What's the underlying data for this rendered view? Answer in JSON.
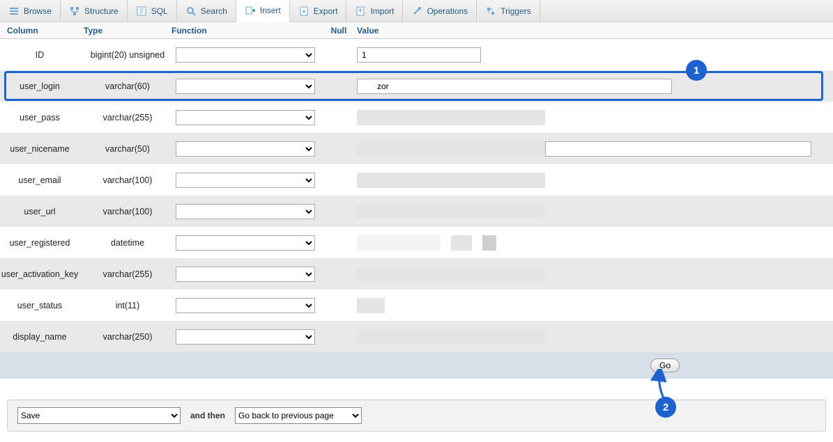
{
  "tabs": [
    {
      "label": "Browse",
      "icon": "browse-icon"
    },
    {
      "label": "Structure",
      "icon": "structure-icon"
    },
    {
      "label": "SQL",
      "icon": "sql-icon"
    },
    {
      "label": "Search",
      "icon": "search-icon"
    },
    {
      "label": "Insert",
      "icon": "insert-icon",
      "active": true
    },
    {
      "label": "Export",
      "icon": "export-icon"
    },
    {
      "label": "Import",
      "icon": "import-icon"
    },
    {
      "label": "Operations",
      "icon": "operations-icon"
    },
    {
      "label": "Triggers",
      "icon": "triggers-icon"
    }
  ],
  "headers": {
    "column": "Column",
    "type": "Type",
    "function": "Function",
    "null": "Null",
    "value": "Value"
  },
  "rows": [
    {
      "column": "ID",
      "type": "bigint(20) unsigned",
      "value": "1",
      "value_width": "short"
    },
    {
      "column": "user_login",
      "type": "varchar(60)",
      "value": "zor",
      "value_width": "long",
      "highlight": true
    },
    {
      "column": "user_pass",
      "type": "varchar(255)",
      "redacted": true
    },
    {
      "column": "user_nicename",
      "type": "varchar(50)",
      "redacted": true,
      "show_input_under": true
    },
    {
      "column": "user_email",
      "type": "varchar(100)",
      "redacted": true
    },
    {
      "column": "user_url",
      "type": "varchar(100)",
      "redacted": true
    },
    {
      "column": "user_registered",
      "type": "datetime",
      "redacted": true
    },
    {
      "column": "user_activation_key",
      "type": "varchar(255)",
      "redacted": true,
      "show_input_under": true
    },
    {
      "column": "user_status",
      "type": "int(11)",
      "redacted": true,
      "redact_style": "short"
    },
    {
      "column": "display_name",
      "type": "varchar(250)",
      "redacted": true
    }
  ],
  "go_label": "Go",
  "footer": {
    "save_label": "Save",
    "and_then": "and then",
    "then_label": "Go back to previous page"
  },
  "annotations": {
    "badge1": "1",
    "badge2": "2"
  }
}
